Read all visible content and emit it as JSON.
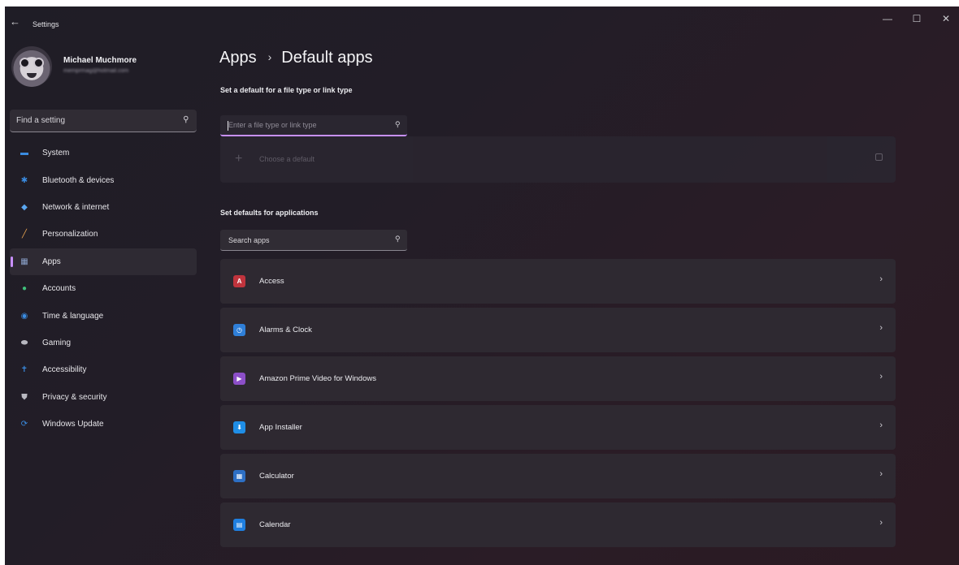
{
  "window": {
    "title": "Settings",
    "back_glyph": "←",
    "controls": {
      "minimize": "—",
      "maximize": "☐",
      "close": "✕"
    }
  },
  "profile": {
    "name": "Michael Muchmore",
    "email": "memprmag@hotmail.com"
  },
  "sidebar_search": {
    "placeholder": "Find a setting",
    "icon": "search-icon"
  },
  "nav": [
    {
      "label": "System",
      "icon": "system-icon",
      "color": "#3a8be0"
    },
    {
      "label": "Bluetooth & devices",
      "icon": "bluetooth-icon",
      "color": "#3a8be0"
    },
    {
      "label": "Network & internet",
      "icon": "wifi-icon",
      "color": "#5aa7f0"
    },
    {
      "label": "Personalization",
      "icon": "brush-icon",
      "color": "#e8a450"
    },
    {
      "label": "Apps",
      "icon": "apps-icon",
      "color": "#8aa0c8",
      "active": true
    },
    {
      "label": "Accounts",
      "icon": "accounts-icon",
      "color": "#3fbf7a"
    },
    {
      "label": "Time & language",
      "icon": "globe-icon",
      "color": "#3a8be0"
    },
    {
      "label": "Gaming",
      "icon": "gamepad-icon",
      "color": "#b8b8c0"
    },
    {
      "label": "Accessibility",
      "icon": "accessibility-icon",
      "color": "#3a8be0"
    },
    {
      "label": "Privacy & security",
      "icon": "shield-icon",
      "color": "#b8b8c0"
    },
    {
      "label": "Windows Update",
      "icon": "update-icon",
      "color": "#3a8be0"
    }
  ],
  "breadcrumb": {
    "parent": "Apps",
    "separator": "›",
    "current": "Default apps"
  },
  "file_type_section": {
    "heading": "Set a default for a file type or link type",
    "placeholder": "Enter a file type or link type",
    "choose_default_label": "Choose a default"
  },
  "apps_section": {
    "heading": "Set defaults for applications",
    "search_placeholder": "Search apps",
    "chevron": "›"
  },
  "apps": [
    {
      "name": "Access",
      "icon": "access-icon",
      "glyph": "A",
      "color": "#c0343d"
    },
    {
      "name": "Alarms & Clock",
      "icon": "clock-icon",
      "glyph": "◷",
      "color": "#2f7fd8"
    },
    {
      "name": "Amazon Prime Video for Windows",
      "icon": "prime-video-icon",
      "glyph": "▶",
      "color": "#8c4fc8"
    },
    {
      "name": "App Installer",
      "icon": "installer-icon",
      "glyph": "⬇",
      "color": "#1f8ee6"
    },
    {
      "name": "Calculator",
      "icon": "calculator-icon",
      "glyph": "▦",
      "color": "#2d6fc4"
    },
    {
      "name": "Calendar",
      "icon": "calendar-icon",
      "glyph": "▤",
      "color": "#1f7fe0"
    }
  ]
}
